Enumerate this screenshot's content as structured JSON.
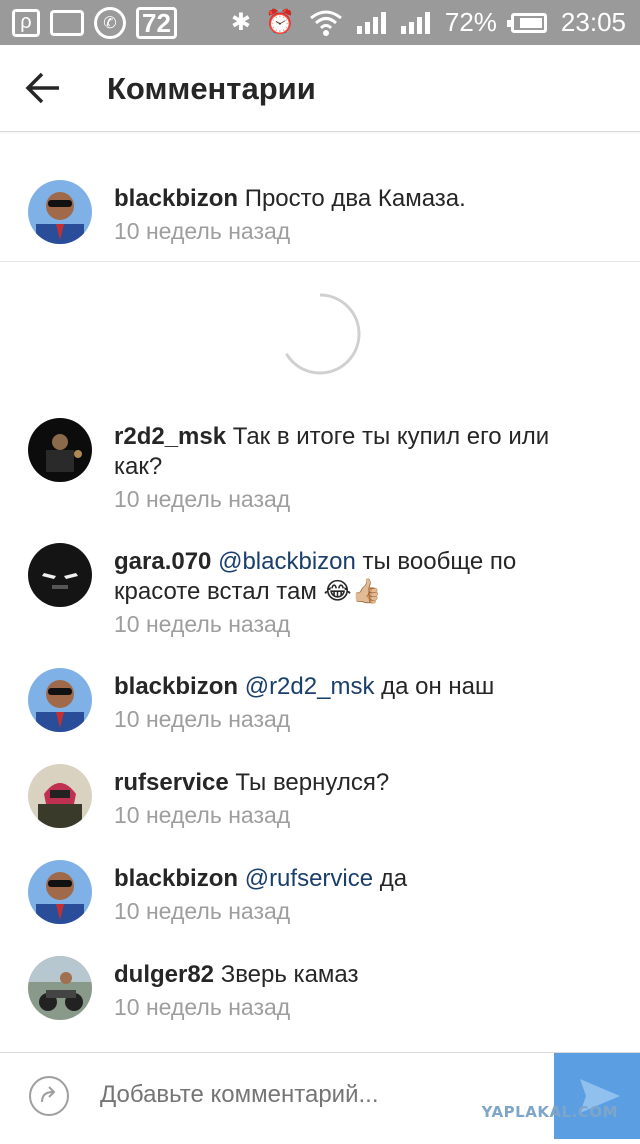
{
  "status_bar": {
    "badge": "72",
    "battery": "72%",
    "time": "23:05",
    "icons": [
      "p-app-icon",
      "gallery-icon",
      "phone-icon",
      "bluetooth-icon",
      "alarm-icon",
      "wifi-icon",
      "signal-icon",
      "signal2-icon",
      "battery-icon"
    ]
  },
  "header": {
    "title": "Комментарии",
    "back_icon": "arrow-left-icon"
  },
  "caption": {
    "username": "blackbizon",
    "text": " Просто два Камаза.",
    "time": "10 недель назад"
  },
  "comments": [
    {
      "username": "r2d2_msk",
      "mention": "",
      "text": " Так в итоге ты купил его или как?",
      "time": "10 недель назад"
    },
    {
      "username": "gara.070",
      "mention": " @blackbizon",
      "text": " ты вообще по красоте встал там 😂👍🏼",
      "time": "10 недель назад"
    },
    {
      "username": "blackbizon",
      "mention": " @r2d2_msk",
      "text": " да он наш",
      "time": "10 недель назад"
    },
    {
      "username": "rufservice",
      "mention": "",
      "text": " Ты вернулся?",
      "time": "10 недель назад"
    },
    {
      "username": "blackbizon",
      "mention": " @rufservice",
      "text": " да",
      "time": "10 недель назад"
    },
    {
      "username": "dulger82",
      "mention": "",
      "text": " Зверь камаз",
      "time": "10 недель назад"
    }
  ],
  "input": {
    "placeholder": "Добавьте комментарий..."
  },
  "watermark": "YAPLAKAL.COM",
  "colors": {
    "mention": "#1b3f6b",
    "time": "#9e9e9e",
    "send": "#5b9ee1",
    "statusbar": "#9a9a9a"
  }
}
